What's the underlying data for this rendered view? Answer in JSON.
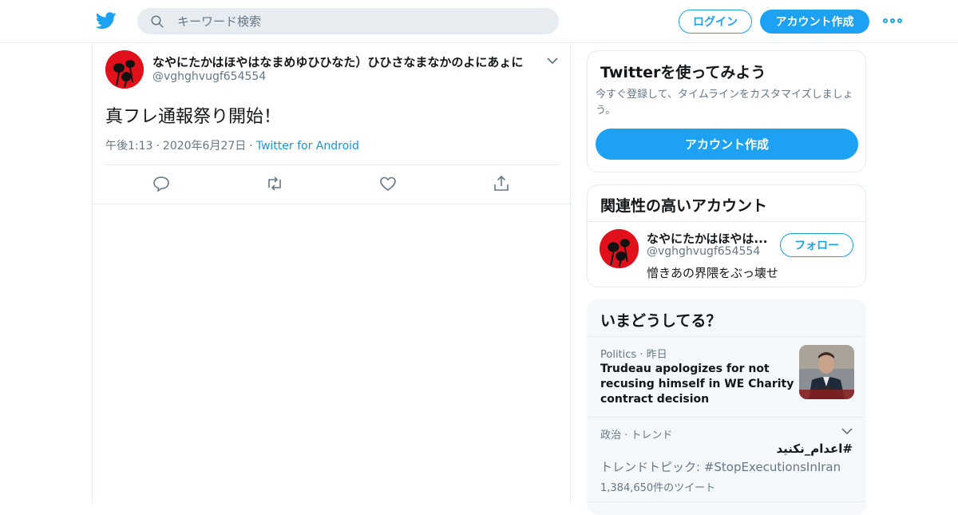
{
  "colors": {
    "accent": "#1da1f2",
    "link": "#1b95e0",
    "muted": "#657786",
    "border": "#e6ecf0",
    "avatar_red": "#e0111a"
  },
  "header": {
    "logo_icon": "twitter-bird-icon",
    "search_placeholder": "キーワード検索",
    "login_label": "ログイン",
    "signup_label": "アカウント作成",
    "more_icon": "more-dots-icon"
  },
  "tweet": {
    "author_name": "なやにたかはほやはなまめゆひひなた）ひひさなまなかのよにあょに",
    "author_handle": "@vghghvugf654554",
    "text": "真フレ通報祭り開始！",
    "time": "午後1:13",
    "date": "2020年6月27日",
    "separator": "·",
    "source": "Twitter for Android",
    "actions": [
      "reply-icon",
      "retweet-icon",
      "like-icon",
      "share-icon"
    ]
  },
  "sidebar": {
    "signup_card": {
      "title": "Twitterを使ってみよう",
      "description": "今すぐ登録して、タイムラインをカスタマイズしましょう。",
      "button": "アカウント作成"
    },
    "related": {
      "title": "関連性の高いアカウント",
      "name": "なやにたかはほやは...",
      "handle": "@vghghvugf654554",
      "bio": "憎きあの界隈をぶっ壊せ",
      "follow_label": "フォロー"
    },
    "trends": {
      "title": "いまどうしてる？",
      "items": [
        {
          "category": "Politics",
          "separator": "·",
          "time": "昨日",
          "headline": "Trudeau apologizes for not recusing himself in WE Charity contract decision"
        },
        {
          "category": "政治 · トレンド",
          "hashtag": "#اعدام_نکنید",
          "topic": "トレンドトピック: #StopExecutionsInIran",
          "count": "1,384,650件のツイート"
        }
      ]
    }
  }
}
